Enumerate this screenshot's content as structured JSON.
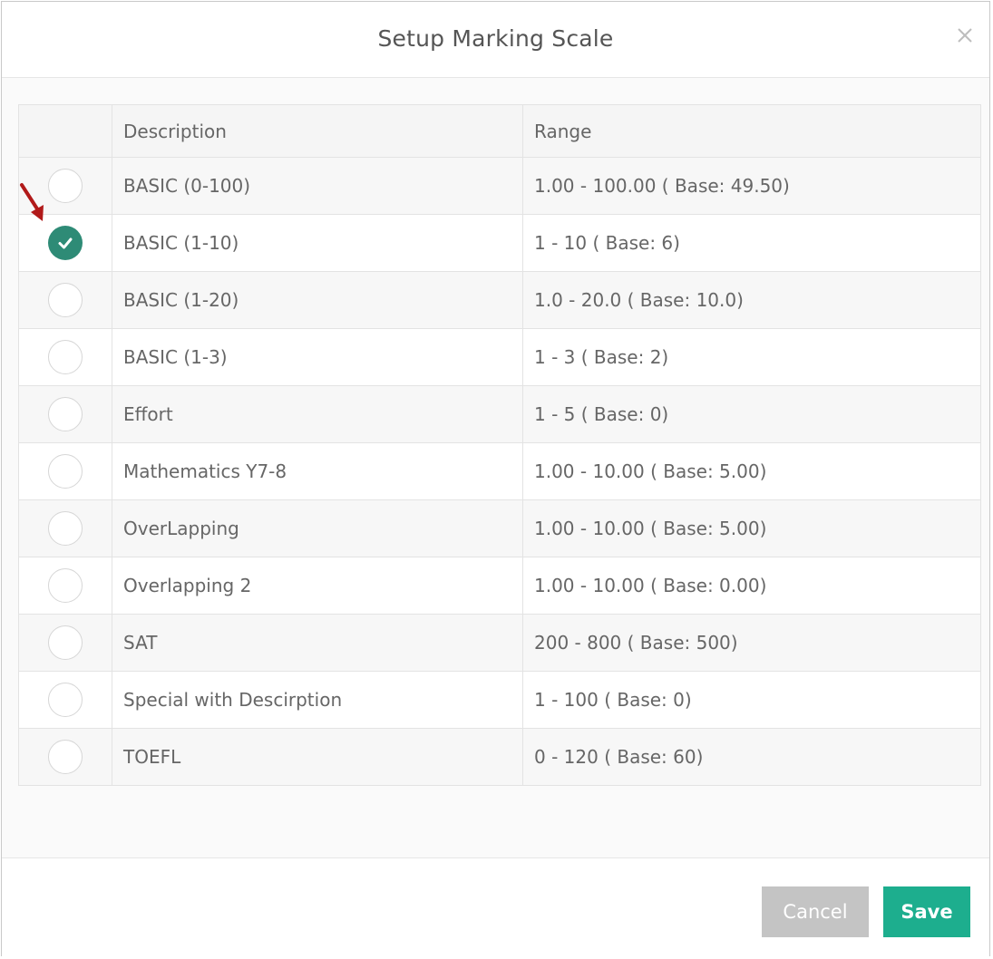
{
  "dialog": {
    "title": "Setup Marking Scale",
    "close_icon": "close-icon"
  },
  "table": {
    "headers": {
      "select": "",
      "description": "Description",
      "range": "Range"
    },
    "rows": [
      {
        "description": "BASIC (0-100)",
        "range": "1.00 - 100.00 ( Base: 49.50)",
        "selected": false
      },
      {
        "description": "BASIC (1-10)",
        "range": "1 - 10 ( Base: 6)",
        "selected": true
      },
      {
        "description": "BASIC (1-20)",
        "range": "1.0 - 20.0 ( Base: 10.0)",
        "selected": false
      },
      {
        "description": "BASIC (1-3)",
        "range": "1 - 3 ( Base: 2)",
        "selected": false
      },
      {
        "description": "Effort",
        "range": "1 - 5 ( Base: 0)",
        "selected": false
      },
      {
        "description": "Mathematics Y7-8",
        "range": "1.00 - 10.00 ( Base: 5.00)",
        "selected": false
      },
      {
        "description": "OverLapping",
        "range": "1.00 - 10.00 ( Base: 5.00)",
        "selected": false
      },
      {
        "description": "Overlapping 2",
        "range": "1.00 - 10.00 ( Base: 0.00)",
        "selected": false
      },
      {
        "description": "SAT",
        "range": "200 - 800 ( Base: 500)",
        "selected": false
      },
      {
        "description": "Special with Descirption",
        "range": "1 - 100 ( Base: 0)",
        "selected": false
      },
      {
        "description": "TOEFL",
        "range": "0 - 120 ( Base: 60)",
        "selected": false
      }
    ]
  },
  "footer": {
    "cancel_label": "Cancel",
    "save_label": "Save"
  },
  "colors": {
    "selected_radio": "#2e8b76",
    "save_button": "#1dae8e",
    "cancel_button": "#c4c4c4",
    "annotation_arrow": "#b11a1a"
  }
}
